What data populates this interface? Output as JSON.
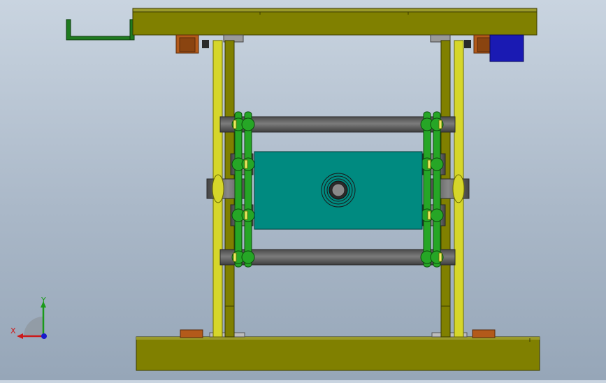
{
  "viewport": {
    "background_top": "#c9d4e0",
    "background_bottom": "#96a6b8"
  },
  "colors": {
    "frame_plate": "#808000",
    "frame_edge": "#3a3a00",
    "vertical_rail": "#d6d62a",
    "link_arm": "#26a626",
    "link_arm_dark": "#157015",
    "shaft": "#5a5a5a",
    "shaft_highlight": "#7c7c7c",
    "center_block": "#008a80",
    "bearing_block": "#b35a1a",
    "motor_block": "#1a1ab3",
    "handle_bracket": "#1f7a1f"
  },
  "triad": {
    "x_label": "X",
    "y_label": "Y",
    "x_color": "#cc1a1a",
    "y_color": "#1a9a1a",
    "origin_color": "#1a1acc"
  }
}
